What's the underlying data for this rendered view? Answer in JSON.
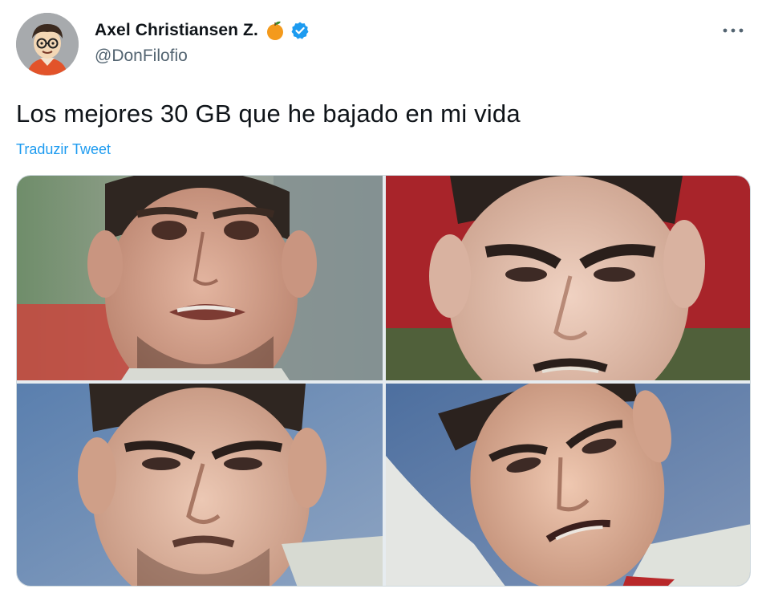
{
  "author": {
    "display_name": "Axel Christiansen Z.",
    "handle": "@DonFilofio",
    "verified": true,
    "name_emoji": "orange-emoji"
  },
  "tweet": {
    "text": "Los mejores 30 GB que he bajado en mi vida",
    "translate_label": "Traduzir Tweet"
  },
  "media": [
    {
      "icon": "photo-face-front"
    },
    {
      "icon": "photo-face-down-red-bg"
    },
    {
      "icon": "photo-face-down-blue-bg"
    },
    {
      "icon": "photo-face-tilted"
    }
  ],
  "colors": {
    "accent": "#1d9bf0",
    "text": "#0f1419",
    "secondary_text": "#536471",
    "emoji_orange": "#f49a1c"
  }
}
